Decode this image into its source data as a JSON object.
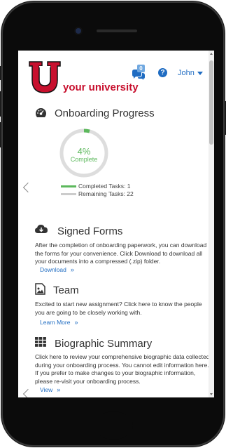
{
  "header": {
    "logo_text": "your university",
    "chat_badge": "0",
    "help_glyph": "?",
    "user_name": "John",
    "icons": {
      "chat": "chat-bubbles-icon",
      "help": "help-circle-icon",
      "caret": "caret-down-icon"
    }
  },
  "progress": {
    "title": "Onboarding Progress",
    "icon": "dashboard-gauge-icon",
    "percent_text": "4%",
    "percent_value": 4,
    "complete_label": "Complete",
    "completed_label": "Completed Tasks: 1",
    "remaining_label": "Remaining Tasks: 22",
    "completed_color": "#5cb85c",
    "remaining_color": "#cccccc"
  },
  "signed_forms": {
    "title": "Signed Forms",
    "icon": "cloud-download-icon",
    "body": "After the completion of onboarding paperwork, you can download the forms for your convenience. Click Download to download all your documents into a compressed (.zip) folder.",
    "link": "Download"
  },
  "team": {
    "title": "Team",
    "icon": "image-icon",
    "body": "Excited to start new assignment? Click here to know the people you are going to be closely working with.",
    "link": "Learn More"
  },
  "biographic": {
    "title": "Biographic Summary",
    "icon": "grid-icon",
    "body": "Click here to review your comprehensive biographic data collected during your onboarding process. You cannot edit information here. If you prefer to make changes to your biographic information, please re-visit your onboarding process.",
    "link": "View"
  },
  "colors": {
    "brand_red": "#c8102e",
    "link_blue": "#1f6cc2"
  }
}
